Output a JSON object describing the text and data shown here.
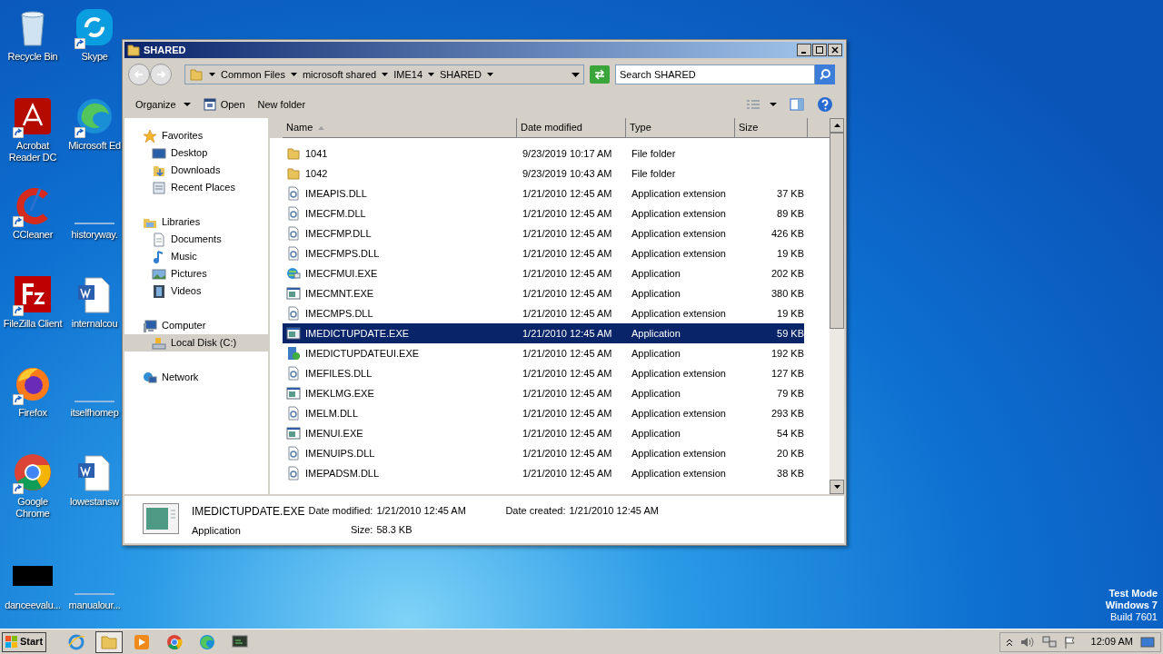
{
  "desktop_icons": [
    {
      "label": "Recycle Bin",
      "kind": "recycle",
      "shortcut": false
    },
    {
      "label": "Skype",
      "kind": "skype",
      "shortcut": true
    },
    {
      "label": "Acrobat Reader DC",
      "kind": "acrobat",
      "shortcut": true
    },
    {
      "label": "Microsoft Ed",
      "kind": "edge",
      "shortcut": true
    },
    {
      "label": "CCleaner",
      "kind": "ccleaner",
      "shortcut": true
    },
    {
      "label": "historyway.",
      "kind": "blank",
      "shortcut": false
    },
    {
      "label": "FileZilla Client",
      "kind": "filezilla",
      "shortcut": true
    },
    {
      "label": "internalcou",
      "kind": "word",
      "shortcut": false
    },
    {
      "label": "Firefox",
      "kind": "firefox",
      "shortcut": true
    },
    {
      "label": "itselfhomep",
      "kind": "blank",
      "shortcut": false
    },
    {
      "label": "Google Chrome",
      "kind": "chrome",
      "shortcut": true
    },
    {
      "label": "lowestansw",
      "kind": "word",
      "shortcut": false
    },
    {
      "label": "danceevalu...",
      "kind": "black",
      "shortcut": false
    },
    {
      "label": "manualour...",
      "kind": "blank",
      "shortcut": false
    }
  ],
  "window": {
    "title": "SHARED",
    "breadcrumb": [
      "Common Files",
      "microsoft shared",
      "IME14",
      "SHARED"
    ],
    "search": {
      "placeholder": "Search SHARED"
    },
    "toolbar": [
      {
        "label": "Organize",
        "kind": "menu"
      },
      {
        "label": "Open",
        "kind": "open"
      },
      {
        "label": "New folder",
        "kind": "plain"
      }
    ],
    "sidebar": [
      {
        "label": "Favorites",
        "kind": "star",
        "selected": false,
        "children": [
          {
            "label": "Desktop",
            "kind": "desktop",
            "selected": false
          },
          {
            "label": "Downloads",
            "kind": "downloads",
            "selected": false
          },
          {
            "label": "Recent Places",
            "kind": "recent",
            "selected": false
          }
        ]
      },
      {
        "label": "Libraries",
        "kind": "libraries",
        "selected": false,
        "children": [
          {
            "label": "Documents",
            "kind": "documents",
            "selected": false
          },
          {
            "label": "Music",
            "kind": "music",
            "selected": false
          },
          {
            "label": "Pictures",
            "kind": "pictures",
            "selected": false
          },
          {
            "label": "Videos",
            "kind": "videos",
            "selected": false
          }
        ]
      },
      {
        "label": "Computer",
        "kind": "computer",
        "selected": false,
        "children": [
          {
            "label": "Local Disk (C:)",
            "kind": "disk",
            "selected": true
          }
        ]
      },
      {
        "label": "Network",
        "kind": "network",
        "selected": false
      }
    ],
    "columns": [
      {
        "label": "Name",
        "sorted": true
      },
      {
        "label": "Date modified",
        "sorted": false
      },
      {
        "label": "Type",
        "sorted": false
      },
      {
        "label": "Size",
        "sorted": false
      }
    ],
    "rows": [
      {
        "name": "1041",
        "date": "9/23/2019 10:17 AM",
        "type": "File folder",
        "size": "",
        "kind": "folder",
        "selected": false
      },
      {
        "name": "1042",
        "date": "9/23/2019 10:43 AM",
        "type": "File folder",
        "size": "",
        "kind": "folder",
        "selected": false
      },
      {
        "name": "IMEAPIS.DLL",
        "date": "1/21/2010 12:45 AM",
        "type": "Application extension",
        "size": "37 KB",
        "kind": "dll",
        "selected": false
      },
      {
        "name": "IMECFM.DLL",
        "date": "1/21/2010 12:45 AM",
        "type": "Application extension",
        "size": "89 KB",
        "kind": "dll",
        "selected": false
      },
      {
        "name": "IMECFMP.DLL",
        "date": "1/21/2010 12:45 AM",
        "type": "Application extension",
        "size": "426 KB",
        "kind": "dll",
        "selected": false
      },
      {
        "name": "IMECFMPS.DLL",
        "date": "1/21/2010 12:45 AM",
        "type": "Application extension",
        "size": "19 KB",
        "kind": "dll",
        "selected": false
      },
      {
        "name": "IMECFMUI.EXE",
        "date": "1/21/2010 12:45 AM",
        "type": "Application",
        "size": "202 KB",
        "kind": "globe",
        "selected": false
      },
      {
        "name": "IMECMNT.EXE",
        "date": "1/21/2010 12:45 AM",
        "type": "Application",
        "size": "380 KB",
        "kind": "exe",
        "selected": false
      },
      {
        "name": "IMECMPS.DLL",
        "date": "1/21/2010 12:45 AM",
        "type": "Application extension",
        "size": "19 KB",
        "kind": "dll",
        "selected": false
      },
      {
        "name": "IMEDICTUPDATE.EXE",
        "date": "1/21/2010 12:45 AM",
        "type": "Application",
        "size": "59 KB",
        "kind": "exe",
        "selected": true
      },
      {
        "name": "IMEDICTUPDATEUI.EXE",
        "date": "1/21/2010 12:45 AM",
        "type": "Application",
        "size": "192 KB",
        "kind": "setup",
        "selected": false
      },
      {
        "name": "IMEFILES.DLL",
        "date": "1/21/2010 12:45 AM",
        "type": "Application extension",
        "size": "127 KB",
        "kind": "dll",
        "selected": false
      },
      {
        "name": "IMEKLMG.EXE",
        "date": "1/21/2010 12:45 AM",
        "type": "Application",
        "size": "79 KB",
        "kind": "exe",
        "selected": false
      },
      {
        "name": "IMELM.DLL",
        "date": "1/21/2010 12:45 AM",
        "type": "Application extension",
        "size": "293 KB",
        "kind": "dll",
        "selected": false
      },
      {
        "name": "IMENUI.EXE",
        "date": "1/21/2010 12:45 AM",
        "type": "Application",
        "size": "54 KB",
        "kind": "exe",
        "selected": false
      },
      {
        "name": "IMENUIPS.DLL",
        "date": "1/21/2010 12:45 AM",
        "type": "Application extension",
        "size": "20 KB",
        "kind": "dll",
        "selected": false
      },
      {
        "name": "IMEPADSM.DLL",
        "date": "1/21/2010 12:45 AM",
        "type": "Application extension",
        "size": "38 KB",
        "kind": "dll",
        "selected": false
      }
    ],
    "details": {
      "name": "IMEDICTUPDATE.EXE",
      "type": "Application",
      "fields": [
        {
          "label": "Date modified:",
          "value": "1/21/2010 12:45 AM"
        },
        {
          "label": "Size:",
          "value": "58.3 KB"
        },
        {
          "label": "Date created:",
          "value": "1/21/2010 12:45 AM"
        }
      ]
    }
  },
  "system_text": [
    "Test Mode",
    "Windows 7",
    "Build 7601"
  ],
  "taskbar": {
    "start": "Start",
    "apps": [
      {
        "kind": "ie",
        "selected": false
      },
      {
        "kind": "explorer",
        "selected": true
      },
      {
        "kind": "media",
        "selected": false
      },
      {
        "kind": "chrome",
        "selected": false
      },
      {
        "kind": "edge",
        "selected": false
      },
      {
        "kind": "monitor",
        "selected": false
      }
    ],
    "clock": "12:09 AM"
  }
}
